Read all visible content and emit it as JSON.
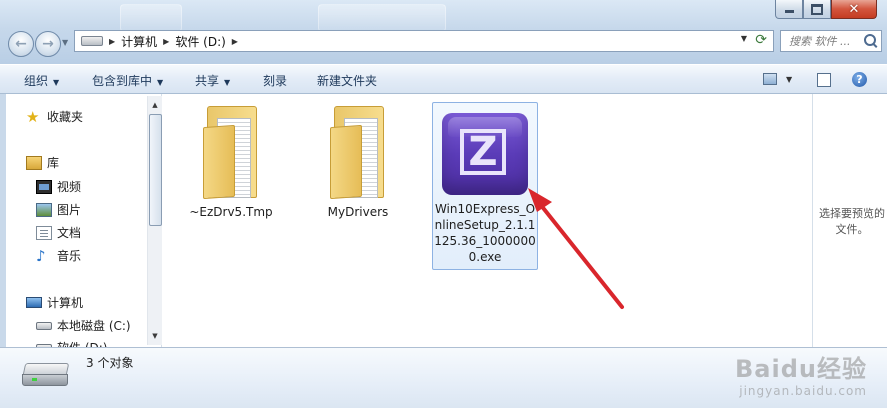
{
  "window": {
    "controls": {
      "minimize_icon": "minimize-icon",
      "maximize_icon": "maximize-icon",
      "close_icon": "close-icon"
    }
  },
  "address_bar": {
    "crumbs": [
      "计算机",
      "软件 (D:)"
    ]
  },
  "search": {
    "placeholder": "搜索 软件 ..."
  },
  "toolbar": {
    "organize": "组织",
    "include_in_library": "包含到库中",
    "share": "共享",
    "burn": "刻录",
    "new_folder": "新建文件夹"
  },
  "nav": {
    "favorites": "收藏夹",
    "libraries": "库",
    "videos": "视频",
    "pictures": "图片",
    "documents": "文档",
    "music": "音乐",
    "computer": "计算机",
    "local_disk_c": "本地磁盘 (C:)",
    "software_d": "软件 (D:)"
  },
  "files": [
    {
      "name": "~EzDrv5.Tmp",
      "type": "folder"
    },
    {
      "name": "MyDrivers",
      "type": "folder"
    },
    {
      "name": "Win10Express_OnlineSetup_2.1.1125.36_10000000.exe",
      "type": "exe",
      "selected": true
    }
  ],
  "preview": {
    "empty_text": "选择要预览的文件。"
  },
  "status": {
    "object_count": "3 个对象"
  },
  "watermark": {
    "line1": "Baidu经验",
    "line2": "jingyan.baidu.com"
  },
  "colors": {
    "accent": "#5b3cb8",
    "annotation_arrow": "#d9262c",
    "selection": "#8db2e3"
  }
}
